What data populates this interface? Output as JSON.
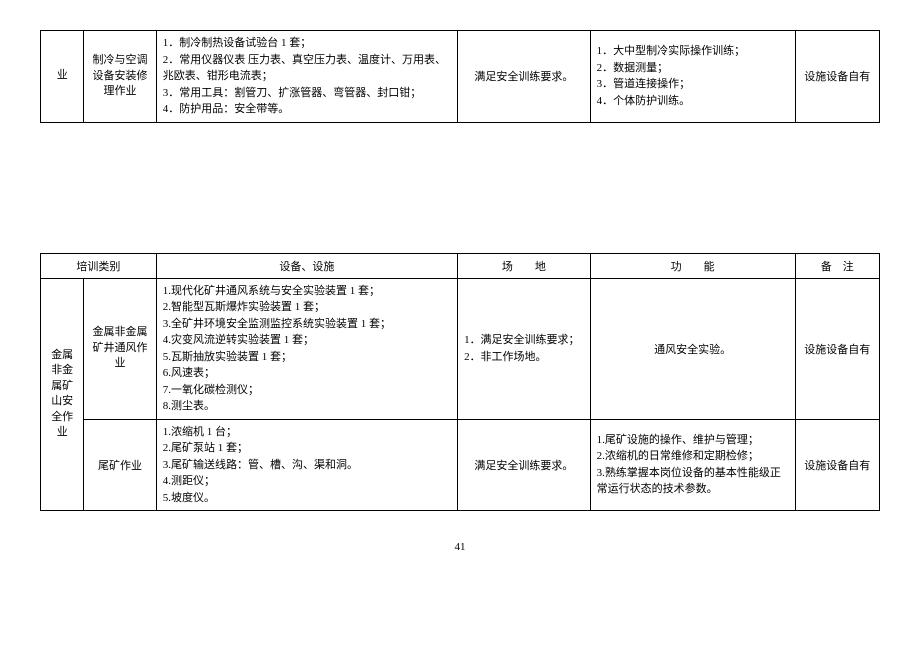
{
  "table1": {
    "rowA": {
      "cat": "业",
      "sub": "制冷与空调设备安装修理作业",
      "equip": "1．制冷制热设备试验台 1 套；\n2．常用仪器仪表 压力表、真空压力表、温度计、万用表、兆欧表、钳形电流表；\n3．常用工具：割管刀、扩涨管器、弯管器、封口钳；\n4．防护用品：安全带等。",
      "site": "满足安全训练要求。",
      "func": "1．大中型制冷实际操作训练；\n2．数据测量；\n3．管道连接操作；\n4．个体防护训练。",
      "note": "设施设备自有"
    }
  },
  "headers": {
    "type": "培训类别",
    "equip": "设备、设施",
    "site": "场　　地",
    "func": "功　　能",
    "note": "备　注"
  },
  "table2": {
    "group": "金属非金属矿山安全作业",
    "rowA": {
      "sub": "金属非金属矿井通风作业",
      "equip": "1.现代化矿井通风系统与安全实验装置 1 套；\n2.智能型瓦斯爆炸实验装置 1 套；\n3.全矿井环境安全监测监控系统实验装置 1 套；\n4.灾变风流逆转实验装置 1 套；\n5.瓦斯抽放实验装置 1 套；\n6.风速表；\n7.一氧化碳检测仪；\n8.测尘表。",
      "site": "1．满足安全训练要求；\n2．非工作场地。",
      "func": "通风安全实验。",
      "note": "设施设备自有"
    },
    "rowB": {
      "sub": "尾矿作业",
      "equip": "1.浓缩机 1 台；\n2.尾矿泵站 1 套；\n3.尾矿输送线路：管、槽、沟、渠和洞。\n4.测距仪；\n5.坡度仪。",
      "site": "满足安全训练要求。",
      "func": "1.尾矿设施的操作、维护与管理；\n2.浓缩机的日常维修和定期检修；\n3.熟练掌握本岗位设备的基本性能级正常运行状态的技术参数。",
      "note": "设施设备自有"
    }
  },
  "pageNumber": "41"
}
